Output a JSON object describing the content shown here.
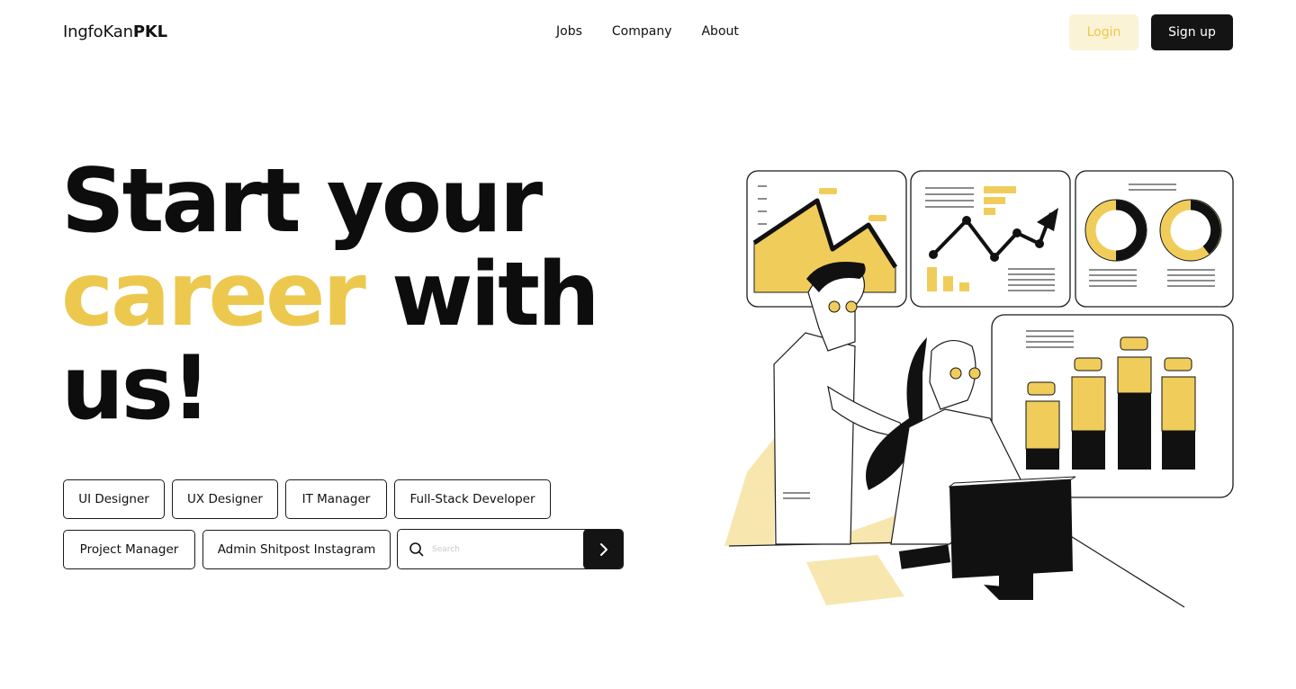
{
  "header": {
    "logo_regular": "IngfoKan",
    "logo_bold": "PKL",
    "nav": [
      "Jobs",
      "Company",
      "About"
    ],
    "login_label": "Login",
    "signup_label": "Sign up"
  },
  "hero": {
    "line1": "Start your",
    "line2_accent": "career",
    "line2_rest": " with",
    "line3": "us!"
  },
  "tags": [
    "UI Designer",
    "UX Designer",
    "IT Manager",
    "Full-Stack Developer",
    "Project Manager",
    "Admin Shitpost Instagram"
  ],
  "search": {
    "placeholder": "Search",
    "icon": "search-icon",
    "submit_icon": "chevron-right-icon"
  },
  "illustration": {
    "subject": "two people analyzing dashboard charts"
  },
  "colors": {
    "accent": "#ecc84e",
    "accent_light": "#fbf3d5",
    "dark": "#141414",
    "text": "#111111",
    "background": "#ffffff"
  }
}
